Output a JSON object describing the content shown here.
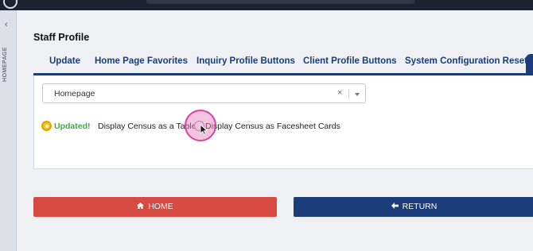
{
  "sidebar": {
    "collapse_glyph": "‹",
    "label": "HOMEPAGE"
  },
  "page": {
    "title": "Staff Profile"
  },
  "tabs": [
    {
      "label": "Update"
    },
    {
      "label": "Home Page Favorites"
    },
    {
      "label": "Inquiry Profile Buttons"
    },
    {
      "label": "Client Profile Buttons"
    },
    {
      "label": "System Configuration Reset"
    }
  ],
  "homepage_select": {
    "value": "Homepage",
    "clear_glyph": "×"
  },
  "census_options": {
    "status": "Updated!",
    "option1": {
      "label": "Display Census as a Table",
      "checked": true
    },
    "option2": {
      "label": "Display Census as Facesheet Cards",
      "checked": false
    }
  },
  "buttons": {
    "home": {
      "label": "HOME",
      "icon": "home-icon"
    },
    "return": {
      "label": "RETURN",
      "icon": "arrow-left-icon"
    }
  },
  "colors": {
    "navy": "#1b3d7a",
    "home_red": "#d64a42",
    "updated_green": "#3cae3f",
    "radio_yellow": "#f7c21a",
    "click_highlight": "#d6459b"
  }
}
